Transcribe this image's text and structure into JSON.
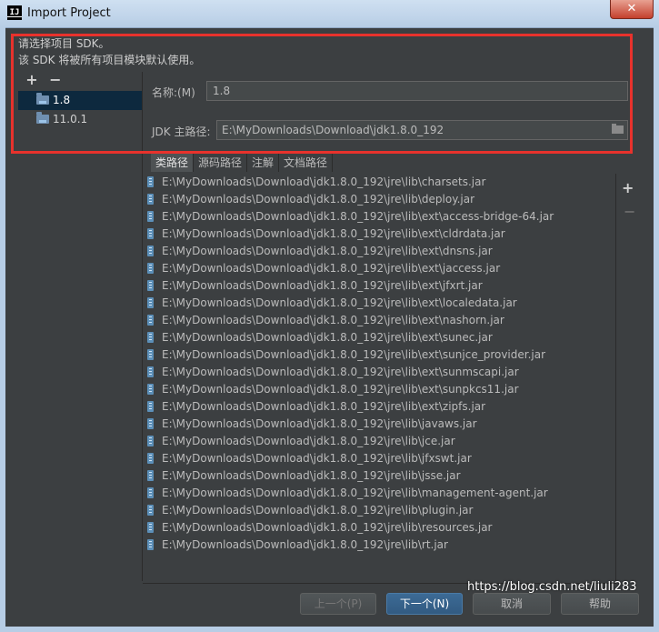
{
  "window": {
    "title": "Import Project",
    "app_icon_text": "IJ",
    "close_glyph": "✕"
  },
  "description": {
    "line1": "请选择项目 SDK。",
    "line2": "该 SDK 将被所有项目模块默认使用。"
  },
  "sdk_toolbar": {
    "add": "+",
    "remove": "−"
  },
  "sdk_list": [
    {
      "label": "1.8",
      "selected": true
    },
    {
      "label": "11.0.1",
      "selected": false
    }
  ],
  "form": {
    "name_label": "名称:(M)",
    "name_value": "1.8",
    "jdk_label": "JDK 主路径:",
    "jdk_value": "E:\\MyDownloads\\Download\\jdk1.8.0_192"
  },
  "tabs": [
    {
      "label": "类路径",
      "active": true
    },
    {
      "label": "源码路径",
      "active": false
    },
    {
      "label": "注解",
      "active": false
    },
    {
      "label": "文档路径",
      "active": false
    }
  ],
  "classpath": [
    "E:\\MyDownloads\\Download\\jdk1.8.0_192\\jre\\lib\\charsets.jar",
    "E:\\MyDownloads\\Download\\jdk1.8.0_192\\jre\\lib\\deploy.jar",
    "E:\\MyDownloads\\Download\\jdk1.8.0_192\\jre\\lib\\ext\\access-bridge-64.jar",
    "E:\\MyDownloads\\Download\\jdk1.8.0_192\\jre\\lib\\ext\\cldrdata.jar",
    "E:\\MyDownloads\\Download\\jdk1.8.0_192\\jre\\lib\\ext\\dnsns.jar",
    "E:\\MyDownloads\\Download\\jdk1.8.0_192\\jre\\lib\\ext\\jaccess.jar",
    "E:\\MyDownloads\\Download\\jdk1.8.0_192\\jre\\lib\\ext\\jfxrt.jar",
    "E:\\MyDownloads\\Download\\jdk1.8.0_192\\jre\\lib\\ext\\localedata.jar",
    "E:\\MyDownloads\\Download\\jdk1.8.0_192\\jre\\lib\\ext\\nashorn.jar",
    "E:\\MyDownloads\\Download\\jdk1.8.0_192\\jre\\lib\\ext\\sunec.jar",
    "E:\\MyDownloads\\Download\\jdk1.8.0_192\\jre\\lib\\ext\\sunjce_provider.jar",
    "E:\\MyDownloads\\Download\\jdk1.8.0_192\\jre\\lib\\ext\\sunmscapi.jar",
    "E:\\MyDownloads\\Download\\jdk1.8.0_192\\jre\\lib\\ext\\sunpkcs11.jar",
    "E:\\MyDownloads\\Download\\jdk1.8.0_192\\jre\\lib\\ext\\zipfs.jar",
    "E:\\MyDownloads\\Download\\jdk1.8.0_192\\jre\\lib\\javaws.jar",
    "E:\\MyDownloads\\Download\\jdk1.8.0_192\\jre\\lib\\jce.jar",
    "E:\\MyDownloads\\Download\\jdk1.8.0_192\\jre\\lib\\jfxswt.jar",
    "E:\\MyDownloads\\Download\\jdk1.8.0_192\\jre\\lib\\jsse.jar",
    "E:\\MyDownloads\\Download\\jdk1.8.0_192\\jre\\lib\\management-agent.jar",
    "E:\\MyDownloads\\Download\\jdk1.8.0_192\\jre\\lib\\plugin.jar",
    "E:\\MyDownloads\\Download\\jdk1.8.0_192\\jre\\lib\\resources.jar",
    "E:\\MyDownloads\\Download\\jdk1.8.0_192\\jre\\lib\\rt.jar"
  ],
  "classpath_toolbar": {
    "add": "+",
    "remove": "−"
  },
  "buttons": {
    "previous": "上一个(P)",
    "next": "下一个(N)",
    "cancel": "取消",
    "help": "帮助"
  },
  "watermark": "https://blog.csdn.net/liuli283",
  "colors": {
    "background": "#3c3f41",
    "selection": "#0d293e",
    "primary_button": "#365f88",
    "highlight_border": "#e8322c"
  }
}
